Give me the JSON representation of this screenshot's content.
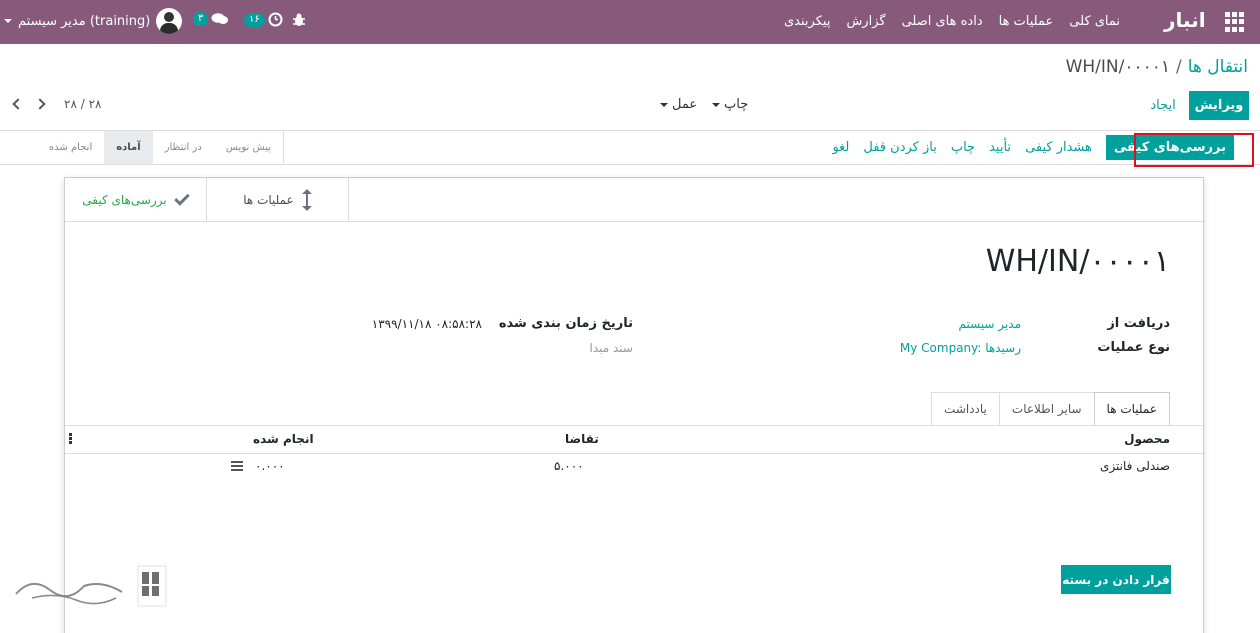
{
  "navbar": {
    "app_name": "انبار",
    "menu": [
      "نمای کلی",
      "عملیات ها",
      "داده های اصلی",
      "گزارش",
      "پیکربندی"
    ],
    "user_name": "مدیر سیستم (training)",
    "messages_count": "۳",
    "activities_count": "۱۶",
    "bg_color": "#875a7b"
  },
  "breadcrumb": {
    "parent": "انتقال ها",
    "separator": "/",
    "current": "WH/IN/۰۰۰۰۱"
  },
  "buttons": {
    "edit": "ویرایش",
    "create": "ایجاد"
  },
  "dropdowns": {
    "print": "چاپ",
    "action": "عمل"
  },
  "pager": {
    "value": "۲۸ / ۲۸"
  },
  "actions": {
    "quality_checks": "بررسی‌های کیفی",
    "quality_alert": "هشدار کیفی",
    "validate": "تأیید",
    "print": "چاپ",
    "unlock": "باز کردن قفل",
    "cancel": "لغو"
  },
  "stages": [
    "پیش نویس",
    "در انتظار",
    "آماده",
    "انجام شده"
  ],
  "active_stage": "آماده",
  "smart_buttons": {
    "operations": "عملیات ها",
    "quality_checks": "بررسی‌های کیفی"
  },
  "record": {
    "title": "WH/IN/۰۰۰۰۱",
    "receive_from_label": "دریافت از",
    "receive_from_value": "مدیر سیستم",
    "op_type_label": "نوع عملیات",
    "op_type_value": "My Company: رسیدها",
    "scheduled_label": "تاریخ زمان بندی شده",
    "scheduled_value": "۱۳۹۹/۱۱/۱۸ ۰۸:۵۸:۲۸",
    "source_doc_label": "سند مبدا"
  },
  "tabs": [
    "عملیات ها",
    "سایر اطلاعات",
    "یادداشت"
  ],
  "table": {
    "columns": {
      "product": "محصول",
      "demand": "تقاضا",
      "done": "انجام شده"
    },
    "rows": [
      {
        "product": "صندلی فانتزی",
        "demand": "۵.۰۰۰",
        "done": "۰.۰۰۰"
      }
    ]
  },
  "put_in_pack": "قرار دادن در بسته",
  "colors": {
    "primary": "#00a09d",
    "highlight": "#e2101a"
  }
}
